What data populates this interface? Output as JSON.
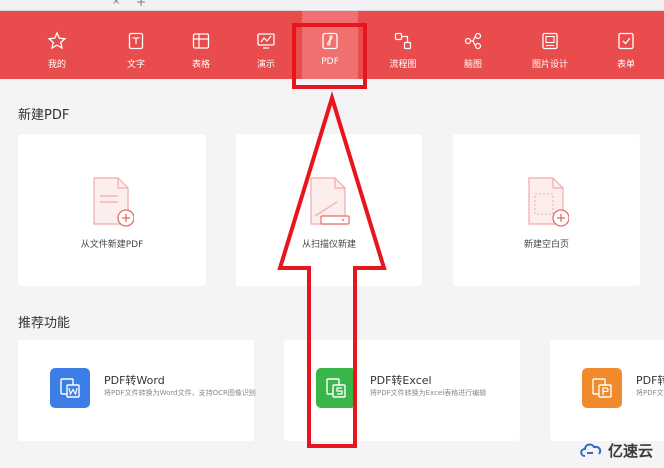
{
  "tabs": {
    "close_glyph": "×",
    "add_glyph": "+"
  },
  "nav": {
    "items": [
      {
        "label": "我的",
        "icon": "star-icon"
      },
      {
        "label": "文字",
        "icon": "document-icon"
      },
      {
        "label": "表格",
        "icon": "table-icon"
      },
      {
        "label": "演示",
        "icon": "presentation-icon"
      },
      {
        "label": "PDF",
        "icon": "pdf-icon",
        "active": true
      },
      {
        "label": "流程图",
        "icon": "flowchart-icon"
      },
      {
        "label": "脑图",
        "icon": "mindmap-icon"
      },
      {
        "label": "图片设计",
        "icon": "image-design-icon"
      },
      {
        "label": "表单",
        "icon": "form-icon"
      }
    ],
    "background": "#e84c4c"
  },
  "new_pdf": {
    "title": "新建PDF",
    "cards": [
      {
        "label": "从文件新建PDF",
        "icon": "file-add-icon"
      },
      {
        "label": "从扫描仪新建",
        "icon": "scanner-icon"
      },
      {
        "label": "新建空白页",
        "icon": "blank-page-add-icon"
      }
    ]
  },
  "recommended": {
    "title": "推荐功能",
    "features": [
      {
        "name": "PDF转Word",
        "desc": "将PDF文件转换为Word文件，支持OCR图像识别",
        "icon": "pdf-to-word-icon",
        "color": "#3d7ee6"
      },
      {
        "name": "PDF转Excel",
        "desc": "将PDF文件转换为Excel表格进行编辑",
        "icon": "pdf-to-excel-icon",
        "color": "#3ab54a"
      },
      {
        "name": "PDF转",
        "desc": "将PDF文",
        "icon": "pdf-to-ppt-icon",
        "color": "#f08a2c"
      }
    ]
  },
  "watermark": {
    "text": "亿速云",
    "icon": "cloud-logo-icon"
  },
  "annotation_color": "#e8141e"
}
